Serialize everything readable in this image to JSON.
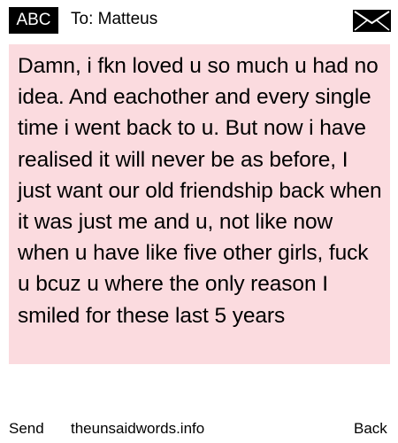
{
  "header": {
    "badge_label": "ABC",
    "recipient": "To: Matteus",
    "envelope_icon": "envelope-icon"
  },
  "message": {
    "text": "Damn, i fkn loved u so much u had no idea. And eachother and every single time i went back to u. But now i have realised it will never be as before, I just want our old friendship back when it was just me and u, not like now when u have like five other girls, fuck u bcuz u where the only reason I smiled for these last 5 years",
    "background_color": "#fbdbdf"
  },
  "footer": {
    "send_label": "Send",
    "site_label": "theunsaidwords.info",
    "back_label": "Back"
  }
}
